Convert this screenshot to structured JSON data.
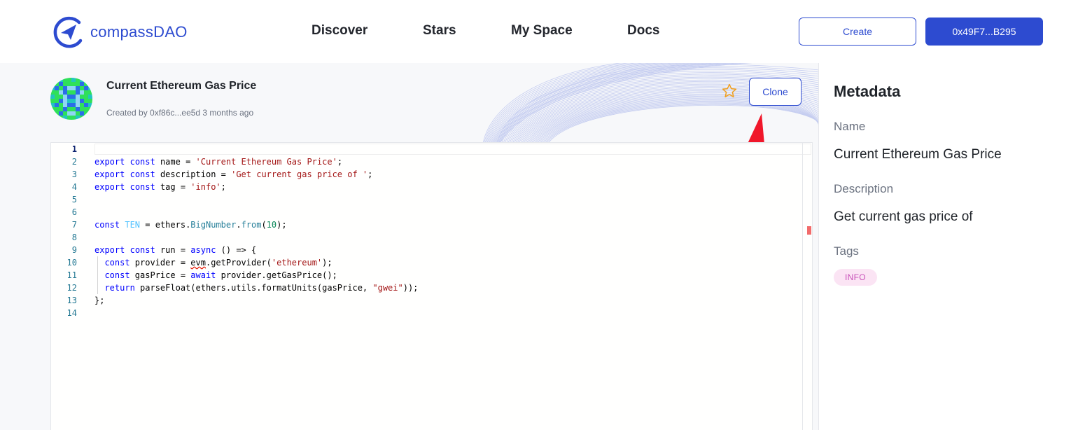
{
  "header": {
    "logo_text": "compassDAO",
    "nav": [
      {
        "label": "Discover"
      },
      {
        "label": "Stars"
      },
      {
        "label": "My Space"
      },
      {
        "label": "Docs"
      }
    ],
    "create_label": "Create",
    "wallet_label": "0x49F7...B295"
  },
  "script": {
    "title": "Current Ethereum Gas Price",
    "created_by": "Created by 0xf86c...ee5d 3 months ago",
    "clone_label": "Clone",
    "star_icon": "star-outline-icon"
  },
  "editor": {
    "line_numbers": [
      "1",
      "2",
      "3",
      "4",
      "5",
      "6",
      "7",
      "8",
      "9",
      "10",
      "11",
      "12",
      "13",
      "14"
    ],
    "active_line": "1",
    "lines": [
      "",
      "export const name = 'Current Ethereum Gas Price';",
      "export const description = 'Get current gas price of ';",
      "export const tag = 'info';",
      "",
      "",
      "const TEN = ethers.BigNumber.from(10);",
      "",
      "export const run = async () => {",
      "  const provider = evm.getProvider('ethereum');",
      "  const gasPrice = await provider.getGasPrice();",
      "  return parseFloat(ethers.utils.formatUnits(gasPrice, \"gwei\"));",
      "};",
      ""
    ]
  },
  "sidebar": {
    "heading": "Metadata",
    "name_label": "Name",
    "name_value": "Current Ethereum Gas Price",
    "description_label": "Description",
    "description_value": "Get current gas price of",
    "tags_label": "Tags",
    "tags": [
      "INFO"
    ]
  },
  "colors": {
    "brand": "#2d4bd0",
    "tag_bg": "#fbe4f4",
    "tag_text": "#c850b9",
    "annotation_arrow": "#f0172a"
  }
}
